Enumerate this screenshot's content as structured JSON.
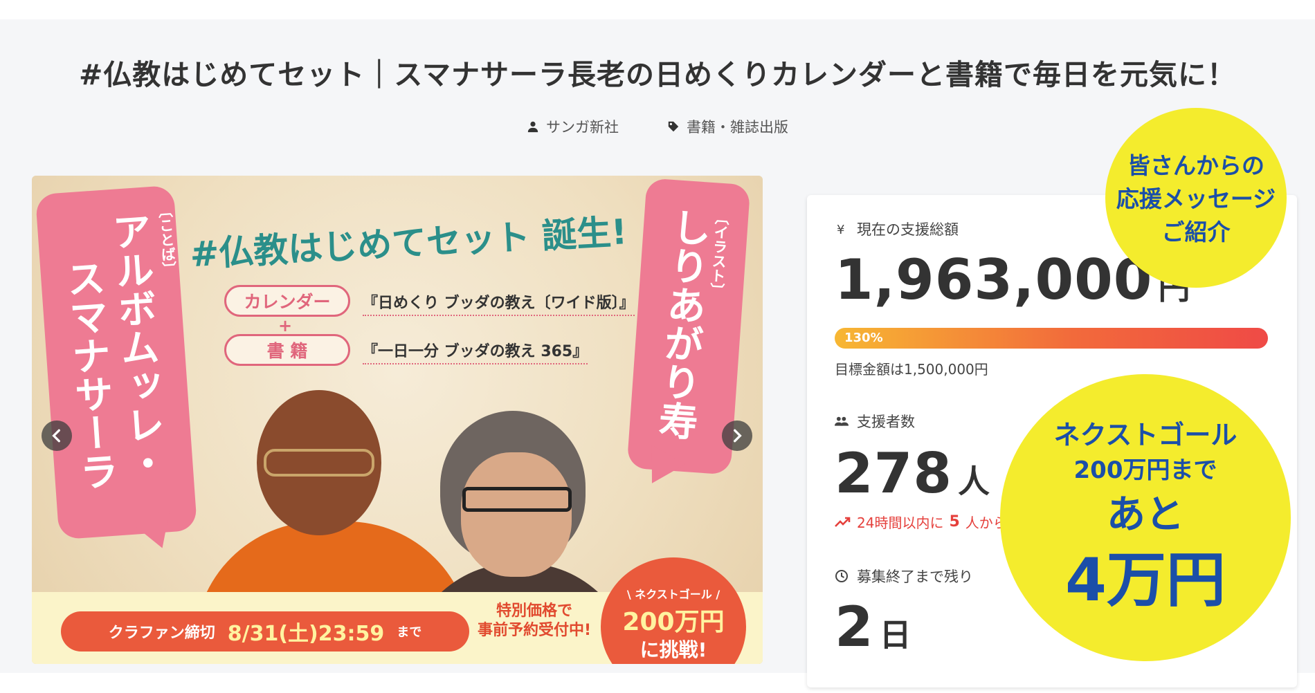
{
  "project": {
    "title": "#仏教はじめてセット｜スマナサーラ長老の日めくりカレンダーと書籍で毎日を元気に！",
    "owner": "サンガ新社",
    "category": "書籍・雑誌出版"
  },
  "banner": {
    "headline": "#仏教はじめてセット 誕生!",
    "left_caption": "〔ことば〕",
    "left_name_line1": "アルボムッレ・",
    "left_name_line2": "スマナサーラ",
    "right_caption": "〔イラスト〕",
    "right_name": "しりあがり寿",
    "calendar_tag": "カレンダー",
    "calendar_product": "『日めくり ブッダの教え〔ワイド版〕』",
    "plus": "+",
    "book_tag": "書 籍",
    "book_product": "『一日一分 ブッダの教え 365』",
    "deadline_label": "クラファン締切",
    "deadline_date": "8/31(土)23:59",
    "deadline_suffix": "まで",
    "special_line1": "特別価格で",
    "special_line2": "事前予約受付中!",
    "goal_line1": "\\ ネクストゴール /",
    "goal_line2": "200万円",
    "goal_line3": "に挑戦!",
    "icons": {
      "prev": "chevron-left-icon",
      "next": "chevron-right-icon"
    }
  },
  "stats": {
    "amount_label": "現在の支援総額",
    "amount_value": "1,963,000",
    "amount_unit": "円",
    "progress_percent": 130,
    "progress_text": "130%",
    "goal_text": "目標金額は1,500,000円",
    "supporters_label": "支援者数",
    "supporters_value": "278",
    "supporters_unit": "人",
    "trend_prefix": "24時間以内に",
    "trend_count": "5",
    "trend_suffix": "人から",
    "remaining_label": "募集終了まで残り",
    "remaining_value": "2",
    "remaining_unit": "日"
  },
  "callouts": {
    "messages_line1": "皆さんからの",
    "messages_line2": "応援メッセージ",
    "messages_line3": "ご紹介",
    "next_goal_line1": "ネクストゴール",
    "next_goal_line2": "200万円まで",
    "next_goal_line3": "あと",
    "next_goal_line4": "4万円"
  },
  "colors": {
    "accent_pink": "#ee7b93",
    "accent_teal": "#2b8f8a",
    "accent_orange": "#ea5a3c",
    "callout_yellow": "#f4ec2d",
    "callout_text": "#1b4fa8",
    "trend_red": "#e5403c"
  }
}
